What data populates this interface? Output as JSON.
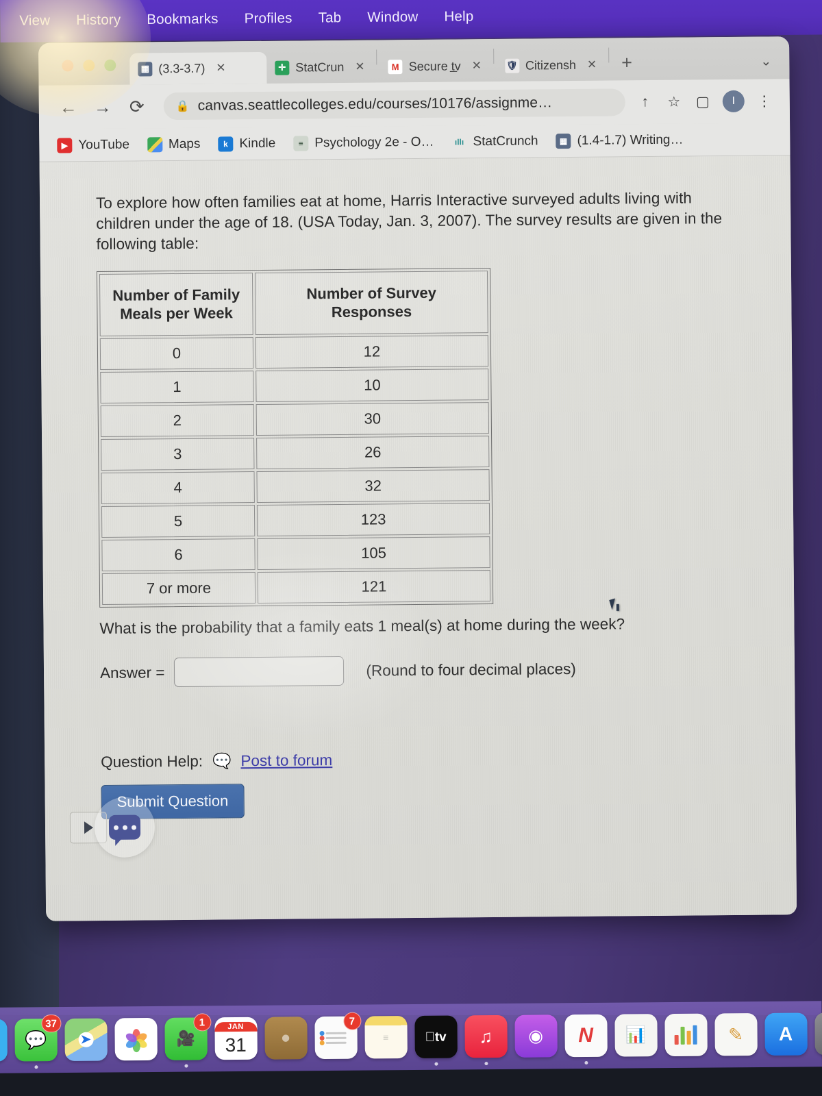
{
  "menubar": {
    "items": [
      "View",
      "History",
      "Bookmarks",
      "Profiles",
      "Tab",
      "Window",
      "Help"
    ]
  },
  "browser": {
    "tabs": [
      {
        "title": "(3.3-3.7)",
        "favicon": "canvas-icon",
        "active": true,
        "close": "✕"
      },
      {
        "title": "StatCrun",
        "favicon": "statcrunch-icon",
        "active": false,
        "close": "✕"
      },
      {
        "title": "Secure t̲v",
        "favicon": "gmail-icon",
        "active": false,
        "close": "✕"
      },
      {
        "title": "Citizensh",
        "favicon": "shield-icon",
        "active": false,
        "close": "✕"
      }
    ],
    "new_tab_label": "+",
    "tab_list_chevron": "⌄",
    "nav": {
      "back": "←",
      "forward": "→",
      "reload": "⟳"
    },
    "omnibox": {
      "lock": "🔒",
      "url": "canvas.seattlecolleges.edu/courses/10176/assignme…"
    },
    "toolbar_icons": {
      "share": "↑",
      "bookmark_star": "☆",
      "side_panel": "▢",
      "profile_initial": "I",
      "overflow_menu": "⋮"
    },
    "bookmarks": [
      {
        "label": "YouTube",
        "icon": "youtube-icon",
        "glyph": "▶"
      },
      {
        "label": "Maps",
        "icon": "google-maps-icon",
        "glyph": ""
      },
      {
        "label": "Kindle",
        "icon": "kindle-icon",
        "glyph": "k"
      },
      {
        "label": "Psychology 2e - O…",
        "icon": "openstax-book-icon",
        "glyph": "≡"
      },
      {
        "label": "StatCrunch",
        "icon": "statcrunch-icon",
        "glyph": "ıllı"
      },
      {
        "label": "(1.4-1.7) Writing…",
        "icon": "canvas-icon",
        "glyph": ""
      }
    ]
  },
  "page": {
    "intro": "To explore how often families eat at home, Harris Interactive surveyed adults living with children under the age of 18. (USA Today, Jan. 3, 2007). The survey results are given in the following table:",
    "table": {
      "headers": [
        "Number of Family Meals per Week",
        "Number of Survey Responses"
      ],
      "rows": [
        [
          "0",
          "12"
        ],
        [
          "1",
          "10"
        ],
        [
          "2",
          "30"
        ],
        [
          "3",
          "26"
        ],
        [
          "4",
          "32"
        ],
        [
          "5",
          "123"
        ],
        [
          "6",
          "105"
        ],
        [
          "7 or more",
          "121"
        ]
      ]
    },
    "question": "What is the probability that a family eats 1 meal(s) at home during the week?",
    "answer_label": "Answer =",
    "answer_value": "",
    "answer_placeholder": "",
    "answer_hint": "(Round to four decimal places)",
    "help_label": "Question Help:",
    "forum_link": "Post to forum",
    "submit_label": "Submit Question",
    "forum_icon": "speech-bubble-icon"
  },
  "chat_widget": {
    "expand_glyph": "▶",
    "bubble_icon": "chat-bubble-icon"
  },
  "dock": {
    "items": [
      {
        "name": "safari",
        "label": "Safari",
        "glyph": "🧭",
        "badge": "",
        "running": true
      },
      {
        "name": "messages",
        "label": "Messages",
        "glyph": "💬",
        "badge": "37",
        "running": true
      },
      {
        "name": "maps",
        "label": "Maps",
        "glyph": "",
        "badge": "",
        "running": false
      },
      {
        "name": "photos",
        "label": "Photos",
        "glyph": "",
        "badge": "",
        "running": false
      },
      {
        "name": "facetime",
        "label": "FaceTime",
        "glyph": "▭",
        "badge": "1",
        "running": true
      },
      {
        "name": "calendar",
        "label": "Calendar",
        "glyph": "",
        "badge": "",
        "running": false,
        "month": "JAN",
        "day": "31"
      },
      {
        "name": "contacts",
        "label": "Contacts",
        "glyph": "👤",
        "badge": "",
        "running": false
      },
      {
        "name": "reminders",
        "label": "Reminders",
        "glyph": "",
        "badge": "7",
        "running": false
      },
      {
        "name": "notes",
        "label": "Notes",
        "glyph": "",
        "badge": "",
        "running": false
      },
      {
        "name": "apple-tv",
        "label": "TV",
        "glyph": "tv",
        "badge": "",
        "running": true
      },
      {
        "name": "music",
        "label": "Music",
        "glyph": "♫",
        "badge": "",
        "running": true
      },
      {
        "name": "podcasts",
        "label": "Podcasts",
        "glyph": "◉",
        "badge": "",
        "running": false
      },
      {
        "name": "news",
        "label": "News",
        "glyph": "N",
        "badge": "",
        "running": true
      },
      {
        "name": "keynote",
        "label": "Keynote",
        "glyph": "",
        "badge": "",
        "running": false
      },
      {
        "name": "numbers",
        "label": "Numbers",
        "glyph": "",
        "badge": "",
        "running": false
      },
      {
        "name": "pages",
        "label": "Pages",
        "glyph": "✎",
        "badge": "",
        "running": false
      },
      {
        "name": "app-store",
        "label": "App Store",
        "glyph": "A",
        "badge": "",
        "running": false
      },
      {
        "name": "system-settings",
        "label": "System Settings",
        "glyph": "⚙",
        "badge": "",
        "running": false
      }
    ]
  },
  "colors": {
    "menubar_purple": "#5730bd",
    "desktop_purple": "#4a3878",
    "desktop_dark": "#2c3347",
    "submit_blue": "#3f67a3",
    "link_blue": "#3c3ca8",
    "badge_red": "#e8392d",
    "page_bg": "#dedeD9"
  }
}
